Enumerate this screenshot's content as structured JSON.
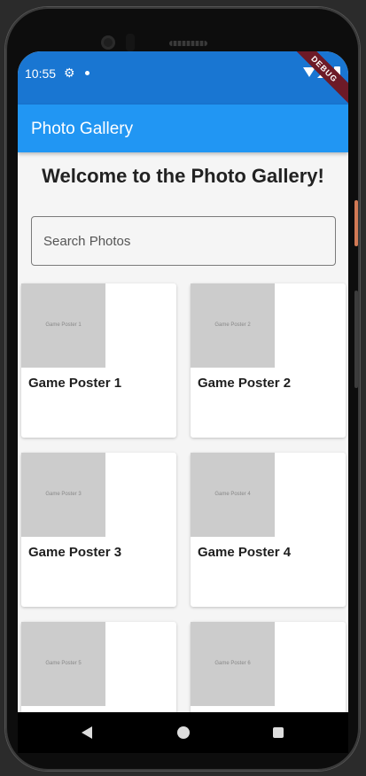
{
  "status_bar": {
    "time": "10:55",
    "debug_banner": "DEBUG"
  },
  "app_bar": {
    "title": "Photo Gallery"
  },
  "welcome": "Welcome to the Photo Gallery!",
  "search": {
    "placeholder": "Search Photos",
    "value": ""
  },
  "photos": [
    {
      "image_text": "Game Poster 1",
      "label": "Game Poster 1"
    },
    {
      "image_text": "Game Poster 2",
      "label": "Game Poster 2"
    },
    {
      "image_text": "Game Poster 3",
      "label": "Game Poster 3"
    },
    {
      "image_text": "Game Poster 4",
      "label": "Game Poster 4"
    },
    {
      "image_text": "Game Poster 5",
      "label": ""
    },
    {
      "image_text": "Game Poster 6",
      "label": ""
    }
  ],
  "colors": {
    "status_bar": "#1976d2",
    "app_bar": "#2196f3",
    "placeholder_image": "#cccccc"
  }
}
